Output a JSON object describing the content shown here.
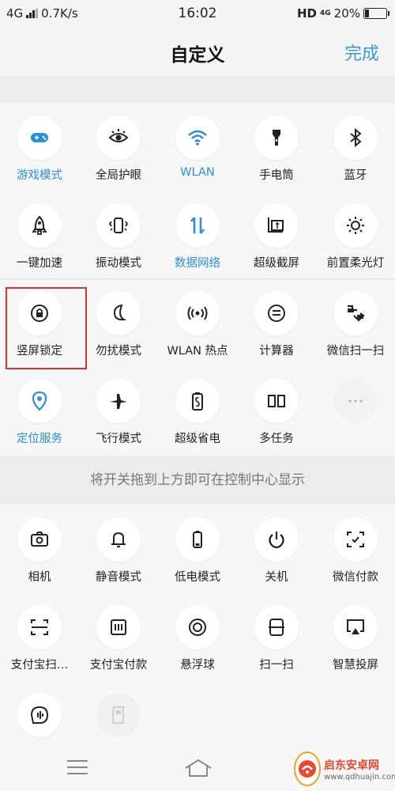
{
  "status": {
    "network": "4G",
    "speed": "0.7K/s",
    "time": "16:02",
    "hd": "HD",
    "net2": "4G",
    "battery_text": "20%",
    "battery_level": 0.2
  },
  "header": {
    "title": "自定义",
    "done": "完成"
  },
  "active_color": "#2d8fd5",
  "active_tiles": {
    "rows": [
      [
        {
          "label": "游戏模式",
          "icon": "gamepad-icon",
          "active": true
        },
        {
          "label": "全局护眼",
          "icon": "eye-icon",
          "active": false
        },
        {
          "label": "WLAN",
          "icon": "wifi-icon",
          "active": true
        },
        {
          "label": "手电筒",
          "icon": "flashlight-icon",
          "active": false
        },
        {
          "label": "蓝牙",
          "icon": "bluetooth-icon",
          "active": false
        }
      ],
      [
        {
          "label": "一键加速",
          "icon": "rocket-icon",
          "active": false
        },
        {
          "label": "振动模式",
          "icon": "vibrate-icon",
          "active": false
        },
        {
          "label": "数据网络",
          "icon": "data-arrows-icon",
          "active": true
        },
        {
          "label": "超级截屏",
          "icon": "screenshot-icon",
          "active": false
        },
        {
          "label": "前置柔光灯",
          "icon": "brightness-icon",
          "active": false
        }
      ],
      [
        {
          "label": "竖屏锁定",
          "icon": "rotation-lock-icon",
          "active": false
        },
        {
          "label": "勿扰模式",
          "icon": "moon-icon",
          "active": false
        },
        {
          "label": "WLAN 热点",
          "icon": "hotspot-icon",
          "active": false
        },
        {
          "label": "计算器",
          "icon": "calculator-icon",
          "active": false
        },
        {
          "label": "微信扫一扫",
          "icon": "wechat-scan-icon",
          "active": false
        }
      ],
      [
        {
          "label": "定位服务",
          "icon": "location-icon",
          "active": true
        },
        {
          "label": "飞行模式",
          "icon": "airplane-icon",
          "active": false
        },
        {
          "label": "超级省电",
          "icon": "battery-saver-icon",
          "active": false
        },
        {
          "label": "多任务",
          "icon": "multitask-icon",
          "active": false
        },
        {
          "label": "",
          "icon": "more-dots-icon",
          "active": false
        }
      ]
    ]
  },
  "hint": "将开关拖到上方即可在控制中心显示",
  "inactive_tiles": {
    "rows": [
      [
        {
          "label": "相机",
          "icon": "camera-icon"
        },
        {
          "label": "静音模式",
          "icon": "bell-icon"
        },
        {
          "label": "低电模式",
          "icon": "low-battery-icon"
        },
        {
          "label": "关机",
          "icon": "power-icon"
        },
        {
          "label": "微信付款",
          "icon": "wechat-pay-icon"
        }
      ],
      [
        {
          "label": "支付宝扫…",
          "icon": "alipay-scan-icon"
        },
        {
          "label": "支付宝付款",
          "icon": "alipay-pay-icon"
        },
        {
          "label": "悬浮球",
          "icon": "float-ball-icon"
        },
        {
          "label": "扫一扫",
          "icon": "scan-icon"
        },
        {
          "label": "智慧投屏",
          "icon": "screen-cast-icon"
        }
      ],
      [
        {
          "label": "",
          "icon": "voice-icon"
        },
        {
          "label": "",
          "icon": "sd-card-icon"
        }
      ]
    ]
  },
  "watermark": {
    "title": "启东安卓网",
    "url": "www.qdhuajin.com"
  }
}
